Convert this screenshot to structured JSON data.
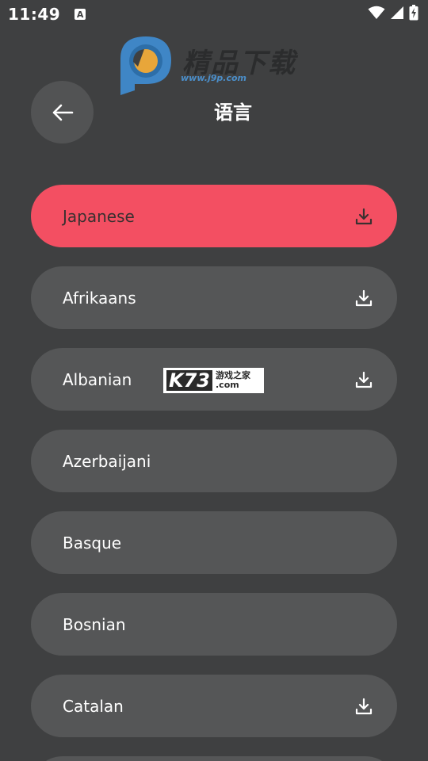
{
  "status_bar": {
    "time": "11:49",
    "notification_letter": "A"
  },
  "watermark": {
    "brand_text": "精品下载",
    "url": "www.j9p.com"
  },
  "header": {
    "title": "语言"
  },
  "languages": [
    {
      "label": "Japanese",
      "downloadable": true,
      "selected": true
    },
    {
      "label": "Afrikaans",
      "downloadable": true,
      "selected": false
    },
    {
      "label": "Albanian",
      "downloadable": true,
      "selected": false
    },
    {
      "label": "Azerbaijani",
      "downloadable": false,
      "selected": false
    },
    {
      "label": "Basque",
      "downloadable": false,
      "selected": false
    },
    {
      "label": "Bosnian",
      "downloadable": false,
      "selected": false
    },
    {
      "label": "Catalan",
      "downloadable": true,
      "selected": false
    }
  ],
  "overlay_badge": {
    "main": "K73",
    "cn": "游戏之家",
    "com": ".com"
  },
  "colors": {
    "background": "#3f4041",
    "item_background": "#555657",
    "accent_selected": "#f34f62",
    "text": "#ffffff"
  }
}
